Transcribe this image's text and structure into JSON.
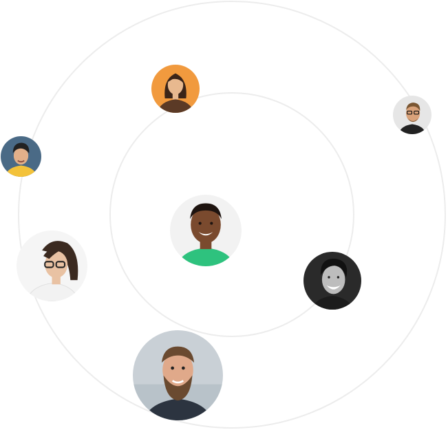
{
  "orbits": {
    "outer": "outer-orbit-ring",
    "inner": "inner-orbit-ring",
    "ring_color": "#ececec"
  },
  "avatars": [
    {
      "id": "center-man-green",
      "description_icon": "person-avatar-icon",
      "bg": "#f2f2f2",
      "shirt": "#2ec27e",
      "skin": "#7a4a2e",
      "hair": "#1e1410"
    },
    {
      "id": "woman-orange-bg",
      "description_icon": "person-avatar-icon",
      "bg": "#f19a3e",
      "shirt": "#5b3a26",
      "skin": "#e8b98f",
      "hair": "#3a2418"
    },
    {
      "id": "man-glasses-topright",
      "description_icon": "person-avatar-icon",
      "bg": "#e6e6e6",
      "shirt": "#222222",
      "skin": "#d9a27a",
      "hair": "#7a5632"
    },
    {
      "id": "young-man-beanie",
      "description_icon": "person-avatar-icon",
      "bg": "#4a6a86",
      "shirt": "#f3c23a",
      "skin": "#e2b08a",
      "hair": "#222222"
    },
    {
      "id": "woman-glasses-laptop",
      "description_icon": "person-avatar-icon",
      "bg": "#f5f5f5",
      "shirt": "#f2f2f2",
      "skin": "#e9c2a3",
      "hair": "#3b2a20"
    },
    {
      "id": "man-bw-smiling",
      "description_icon": "person-avatar-icon",
      "bg": "#2a2a2a",
      "shirt": "#1c1c1c",
      "skin": "#bdbdbd",
      "hair": "#111111"
    },
    {
      "id": "bearded-man-bottom",
      "description_icon": "person-avatar-icon",
      "bg": "#c9d0d6",
      "shirt": "#2c3440",
      "skin": "#e0a98a",
      "hair": "#6a4a30"
    }
  ]
}
